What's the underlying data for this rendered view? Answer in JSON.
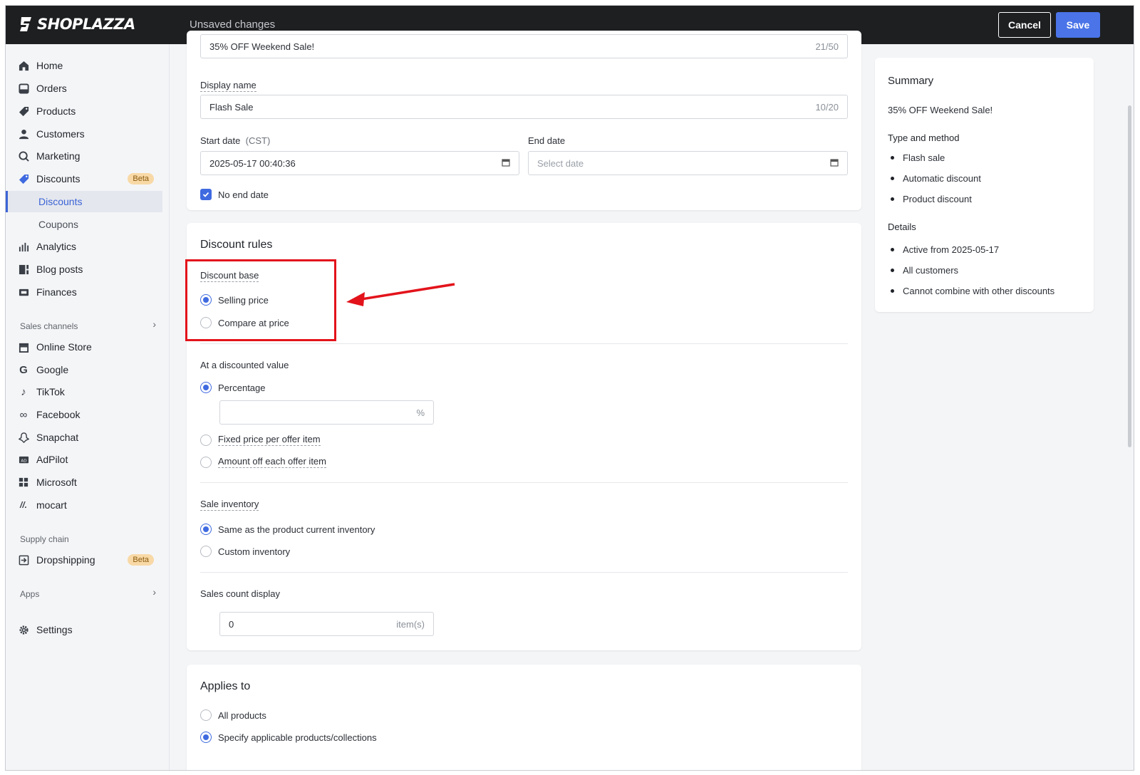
{
  "topbar": {
    "logo_text": "SHOPLAZZA",
    "status": "Unsaved changes",
    "cancel_label": "Cancel",
    "save_label": "Save"
  },
  "sidebar": {
    "items": [
      {
        "label": "Home",
        "icon": "home-icon"
      },
      {
        "label": "Orders",
        "icon": "orders-icon"
      },
      {
        "label": "Products",
        "icon": "tag-icon"
      },
      {
        "label": "Customers",
        "icon": "person-icon"
      },
      {
        "label": "Marketing",
        "icon": "megaphone-icon"
      },
      {
        "label": "Discounts",
        "icon": "discount-icon",
        "badge": "Beta"
      }
    ],
    "sub_items": [
      "Discounts",
      "Coupons"
    ],
    "items2": [
      {
        "label": "Analytics",
        "icon": "bar-chart-icon"
      },
      {
        "label": "Blog posts",
        "icon": "blog-icon"
      },
      {
        "label": "Finances",
        "icon": "finance-icon"
      }
    ],
    "sales_channels_label": "Sales channels",
    "channels": [
      {
        "label": "Online Store",
        "icon": "store-icon"
      },
      {
        "label": "Google",
        "icon": "google-icon"
      },
      {
        "label": "TikTok",
        "icon": "tiktok-icon"
      },
      {
        "label": "Facebook",
        "icon": "meta-icon"
      },
      {
        "label": "Snapchat",
        "icon": "snapchat-icon"
      },
      {
        "label": "AdPilot",
        "icon": "ad-icon"
      },
      {
        "label": "Microsoft",
        "icon": "microsoft-icon"
      },
      {
        "label": "mocart",
        "icon": "mocart-icon"
      }
    ],
    "supply_chain_label": "Supply chain",
    "dropshipping": {
      "label": "Dropshipping",
      "badge": "Beta"
    },
    "apps_label": "Apps",
    "settings_label": "Settings"
  },
  "form": {
    "title_value": "35% OFF Weekend Sale!",
    "title_count": "21/50",
    "display_name_label": "Display name",
    "display_name_value": "Flash Sale",
    "display_name_count": "10/20",
    "start_date_label": "Start date",
    "start_date_tz": "(CST)",
    "start_date_value": "2025-05-17 00:40:36",
    "end_date_label": "End date",
    "end_date_placeholder": "Select date",
    "no_end_date_label": "No end date"
  },
  "rules": {
    "title": "Discount rules",
    "discount_base_label": "Discount base",
    "selling_price": "Selling price",
    "compare_at_price": "Compare at price",
    "discounted_value_label": "At a discounted value",
    "percentage": "Percentage",
    "percentage_suffix": "%",
    "fixed_price": "Fixed price per offer item",
    "amount_off": "Amount off each offer item",
    "inventory_label": "Sale inventory",
    "same_inventory": "Same as the product current inventory",
    "custom_inventory": "Custom inventory",
    "sales_count_label": "Sales count display",
    "sales_count_value": "0",
    "sales_count_suffix": "item(s)"
  },
  "applies": {
    "title": "Applies to",
    "all_products": "All products",
    "specify": "Specify applicable products/collections"
  },
  "summary": {
    "title": "Summary",
    "name": "35% OFF Weekend Sale!",
    "type_heading": "Type and method",
    "type_items": [
      "Flash sale",
      "Automatic discount",
      "Product discount"
    ],
    "details_heading": "Details",
    "details_items": [
      "Active from 2025-05-17",
      "All customers",
      "Cannot combine with other discounts"
    ]
  },
  "colors": {
    "accent": "#3f6ae0",
    "save_button": "#4a74e8",
    "annotation": "#e3131b",
    "topbar": "#1e1f21"
  }
}
